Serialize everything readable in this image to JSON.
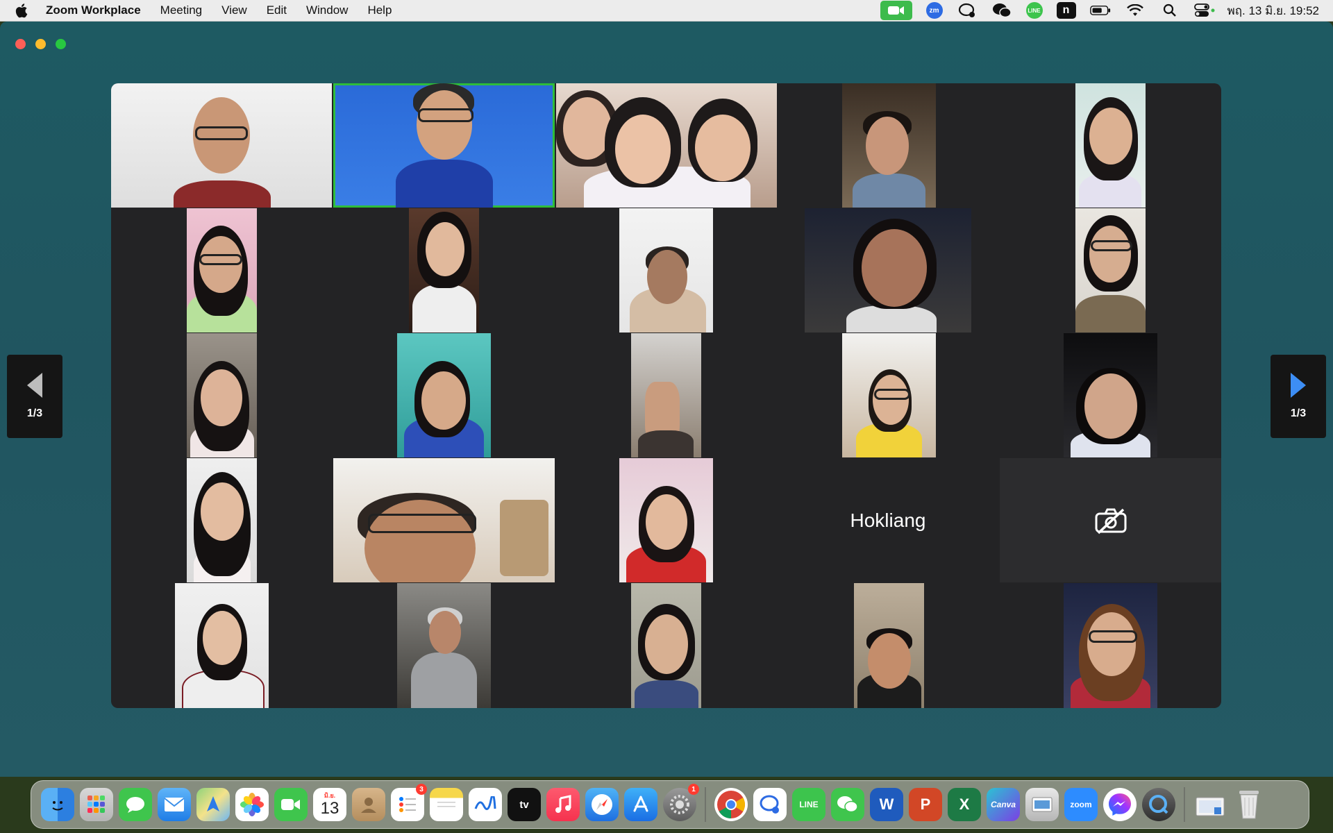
{
  "menubar": {
    "app_name": "Zoom Workplace",
    "items": [
      "Meeting",
      "View",
      "Edit",
      "Window",
      "Help"
    ],
    "zm_label": "zm",
    "line_label": "LINE",
    "n_label": "n",
    "clock": "พฤ. 13 มิ.ย.  19:52"
  },
  "gallery": {
    "name_tile_label": "Hokliang",
    "page_indicator_left": "1/3",
    "page_indicator_right": "1/3"
  },
  "dock": {
    "calendar_month": "มิ.ย.",
    "calendar_day": "13",
    "reminders_badge": "3",
    "settings_badge": "1",
    "tv_label": "tv",
    "line_label": "LINE",
    "word_label": "W",
    "ppt_label": "P",
    "excel_label": "X",
    "canva_label": "Canva",
    "zoom_label": "zoom"
  }
}
